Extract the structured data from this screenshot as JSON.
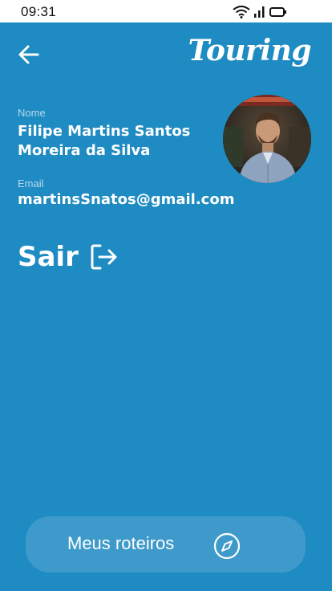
{
  "status_bar": {
    "time": "09:31",
    "icons": [
      "wifi-icon",
      "signal-icon",
      "battery-icon"
    ]
  },
  "header": {
    "back_icon": "arrow-left-icon",
    "brand": "Touring"
  },
  "profile": {
    "name_label": "Nome",
    "name_value": "Filipe Martins Santos Moreira da Silva",
    "email_label": "Email",
    "email_value": "martinsSnatos@gmail.com",
    "avatar": "avatar"
  },
  "logout": {
    "label": "Sair",
    "icon": "logout-icon"
  },
  "bottom_button": {
    "label": "Meus roteiros",
    "icon": "compass-icon"
  },
  "colors": {
    "background": "#1e8bc3",
    "button_bg": "#3e9acb",
    "text": "#ffffff",
    "label": "#b8d9ee"
  }
}
